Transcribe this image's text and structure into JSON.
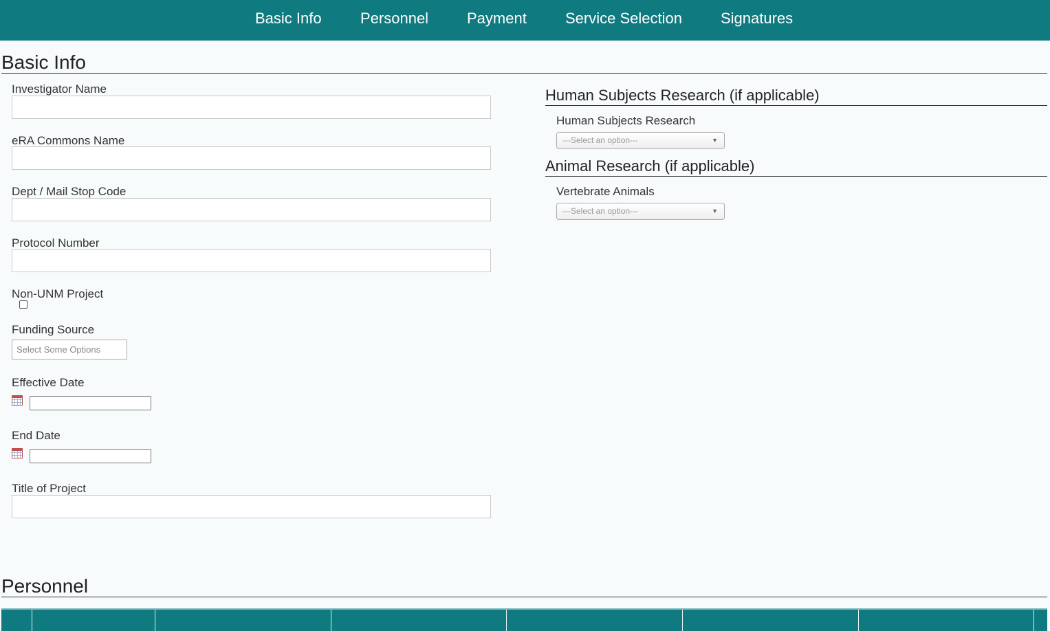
{
  "nav": {
    "items": [
      {
        "label": "Basic Info"
      },
      {
        "label": "Personnel"
      },
      {
        "label": "Payment"
      },
      {
        "label": "Service Selection"
      },
      {
        "label": "Signatures"
      }
    ]
  },
  "basic_info": {
    "title": "Basic Info",
    "investigator_name": {
      "label": "Investigator Name",
      "value": ""
    },
    "era_commons_name": {
      "label": "eRA Commons Name",
      "value": ""
    },
    "dept_mail_stop": {
      "label": "Dept / Mail Stop Code",
      "value": ""
    },
    "protocol_number": {
      "label": "Protocol Number",
      "value": ""
    },
    "non_unm_project": {
      "label": "Non-UNM Project",
      "checked": false
    },
    "funding_source": {
      "label": "Funding Source",
      "placeholder": "Select Some Options"
    },
    "effective_date": {
      "label": "Effective Date",
      "value": "",
      "icon": "calendar-icon"
    },
    "end_date": {
      "label": "End Date",
      "value": "",
      "icon": "calendar-icon"
    },
    "title_of_project": {
      "label": "Title of Project",
      "value": ""
    }
  },
  "human_subjects": {
    "title": "Human Subjects Research (if applicable)",
    "field_label": "Human Subjects Research",
    "selected": "---Select an option---"
  },
  "animal_research": {
    "title": "Animal Research (if applicable)",
    "field_label": "Vertebrate Animals",
    "selected": "---Select an option---"
  },
  "personnel": {
    "title": "Personnel"
  },
  "colors": {
    "accent": "#0f7a7f",
    "background": "#f7fbfc"
  }
}
